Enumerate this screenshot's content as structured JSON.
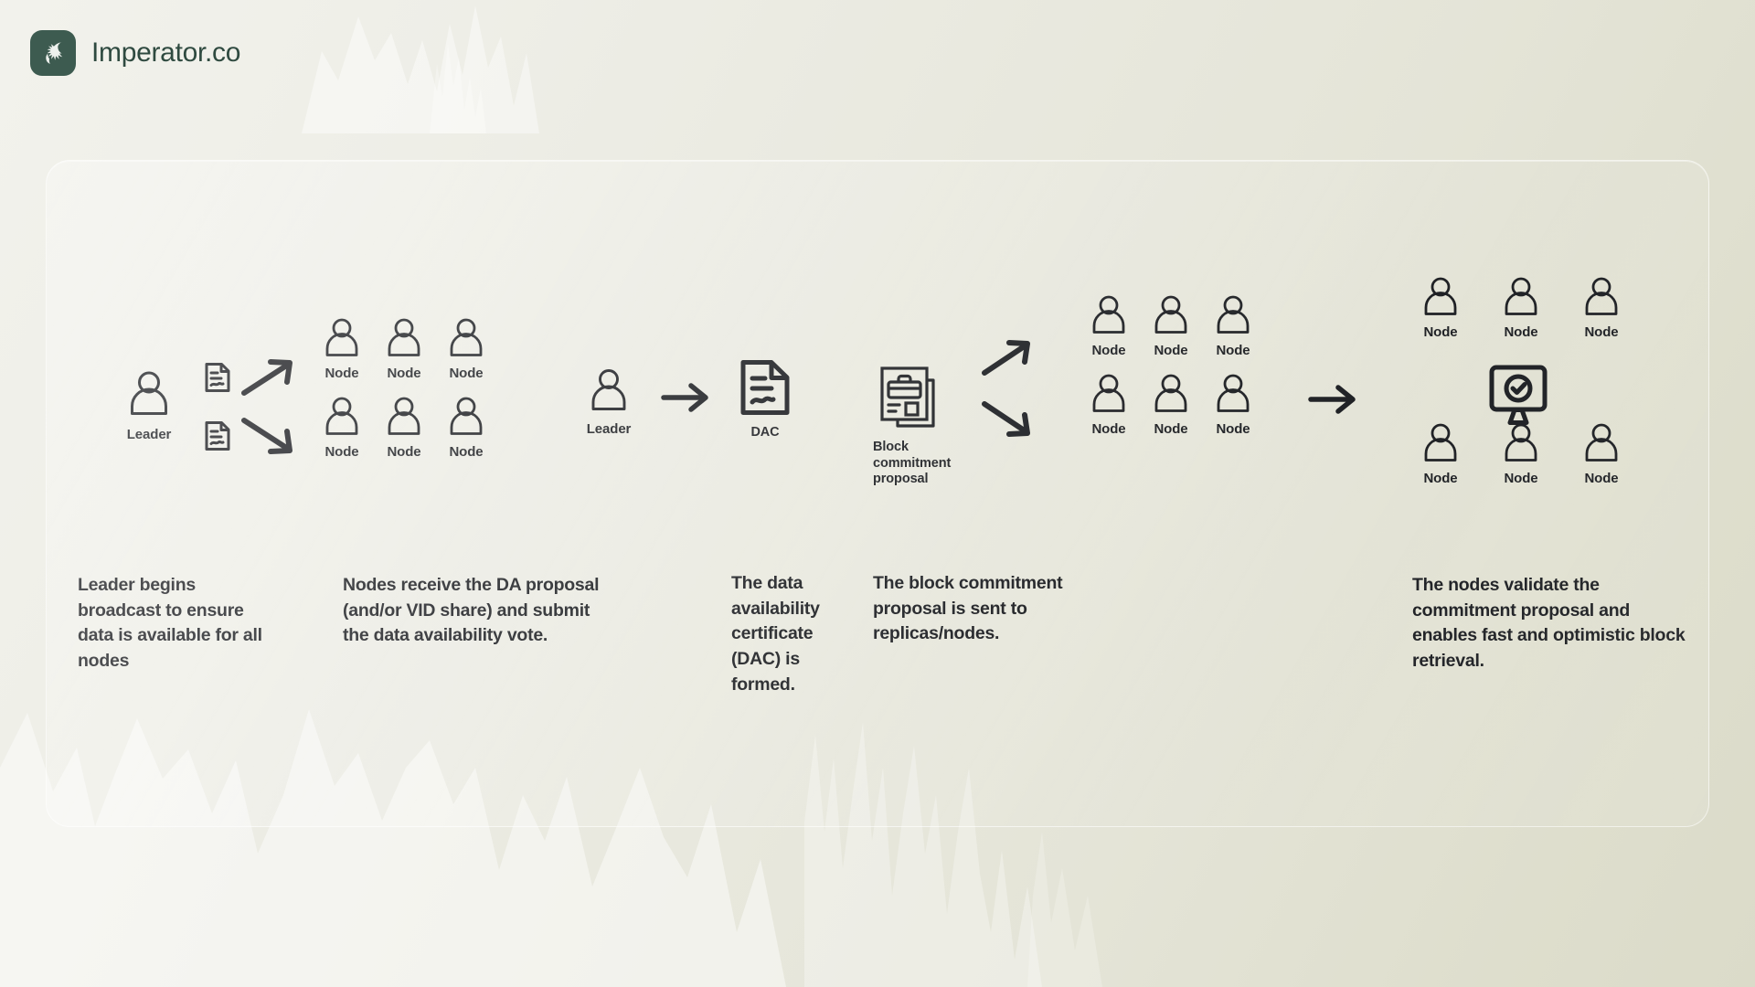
{
  "brand": {
    "name": "Imperator.co",
    "logo_icon": "spartan-helmet-icon",
    "logo_bg": "#3d5b50",
    "text_color": "#2f4a40"
  },
  "diagram": {
    "title_hidden": "",
    "steps": [
      {
        "id": "step-1-leader-broadcast",
        "caption": "Leader begins broadcast to ensure data is available for all nodes",
        "actors": [
          {
            "type": "person",
            "label": "Leader"
          }
        ],
        "documents": [
          {
            "icon": "document-signed-icon"
          },
          {
            "icon": "document-signed-icon"
          }
        ],
        "arrows": [
          "arrow-up-right-icon",
          "arrow-down-right-icon"
        ]
      },
      {
        "id": "step-2-nodes-vote",
        "caption": "Nodes receive the DA proposal (and/or VID share) and submit the data availability vote.",
        "nodes": [
          {
            "label": "Node"
          },
          {
            "label": "Node"
          },
          {
            "label": "Node"
          },
          {
            "label": "Node"
          },
          {
            "label": "Node"
          },
          {
            "label": "Node"
          }
        ]
      },
      {
        "id": "step-3-dac-formed",
        "caption": "The data availability certificate (DAC) is formed.",
        "actors": [
          {
            "type": "person",
            "label": "Leader"
          }
        ],
        "arrows": [
          "arrow-right-icon"
        ],
        "artifact": {
          "icon": "certificate-document-icon",
          "label": "DAC"
        }
      },
      {
        "id": "step-4-commitment-sent",
        "caption": "The block commitment proposal is sent to replicas/nodes.",
        "artifact": {
          "icon": "block-commitment-proposal-icon",
          "label": "Block commitment proposal"
        },
        "arrows": [
          "arrow-up-right-icon",
          "arrow-down-right-icon"
        ],
        "nodes": [
          {
            "label": "Node"
          },
          {
            "label": "Node"
          },
          {
            "label": "Node"
          },
          {
            "label": "Node"
          },
          {
            "label": "Node"
          },
          {
            "label": "Node"
          }
        ]
      },
      {
        "id": "step-5-nodes-validate",
        "caption": "The nodes validate the commitment proposal  and enables fast and optimistic block retrieval.",
        "arrows": [
          "arrow-right-icon"
        ],
        "nodes": [
          {
            "label": "Node"
          },
          {
            "label": "Node"
          },
          {
            "label": "Node"
          },
          {
            "label": "Node"
          },
          {
            "label": "Node"
          },
          {
            "label": "Node"
          }
        ],
        "artifact": {
          "icon": "monitor-check-icon",
          "label": ""
        }
      }
    ],
    "stroke_color": "#14161a",
    "card_radius_px": 26
  }
}
